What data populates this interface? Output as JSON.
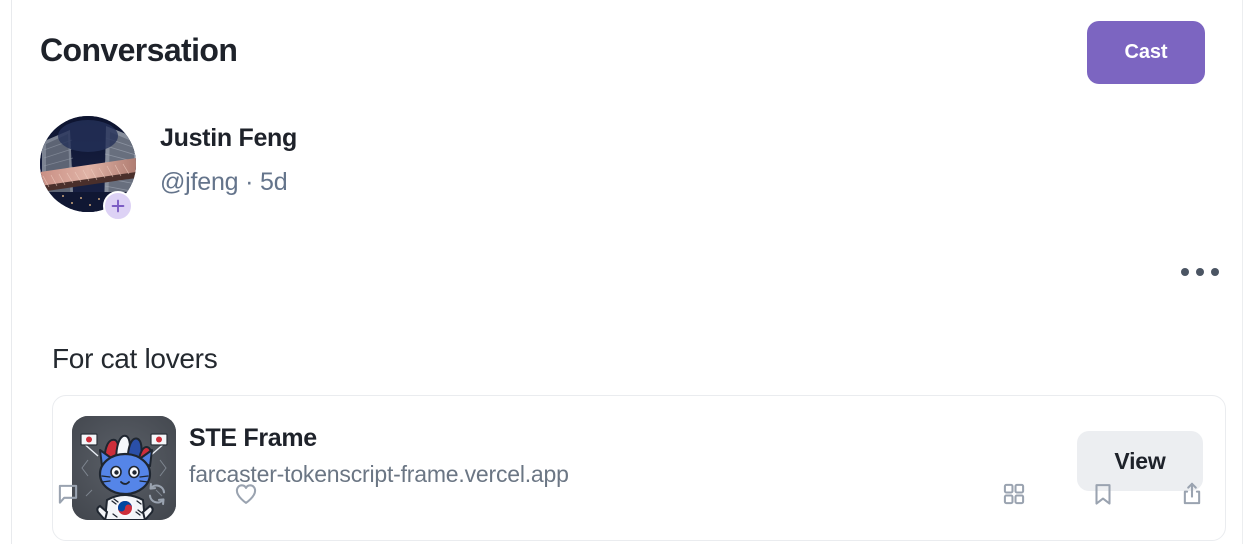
{
  "header": {
    "title": "Conversation",
    "cast_button_label": "Cast",
    "cast_button_color": "#7c65c1"
  },
  "cast": {
    "author": {
      "display_name": "Justin Feng",
      "handle": "@jfeng",
      "timestamp": "5d",
      "meta_line": "@jfeng · 5d",
      "avatar_icon": "city-skyline-avatar",
      "avatar_badge_icon": "plus-icon",
      "avatar_badge_color": "#ddd2f5"
    },
    "text": "For cat lovers",
    "more_menu_icon": "ellipsis-icon",
    "embed": {
      "title": "STE Frame",
      "url": "farcaster-tokenscript-frame.vercel.app",
      "thumbnail_icon": "blue-cat-frame-thumbnail",
      "view_button_label": "View"
    }
  },
  "actions": {
    "left": [
      {
        "name": "comment-button",
        "icon": "speech-bubble-icon"
      },
      {
        "name": "recast-button",
        "icon": "recycle-arrows-icon"
      },
      {
        "name": "like-button",
        "icon": "heart-icon"
      }
    ],
    "right": [
      {
        "name": "apps-grid-button",
        "icon": "grid-squares-icon"
      },
      {
        "name": "bookmark-button",
        "icon": "bookmark-icon"
      },
      {
        "name": "share-button",
        "icon": "share-upload-icon"
      }
    ],
    "icon_color": "#9aa3b0"
  }
}
